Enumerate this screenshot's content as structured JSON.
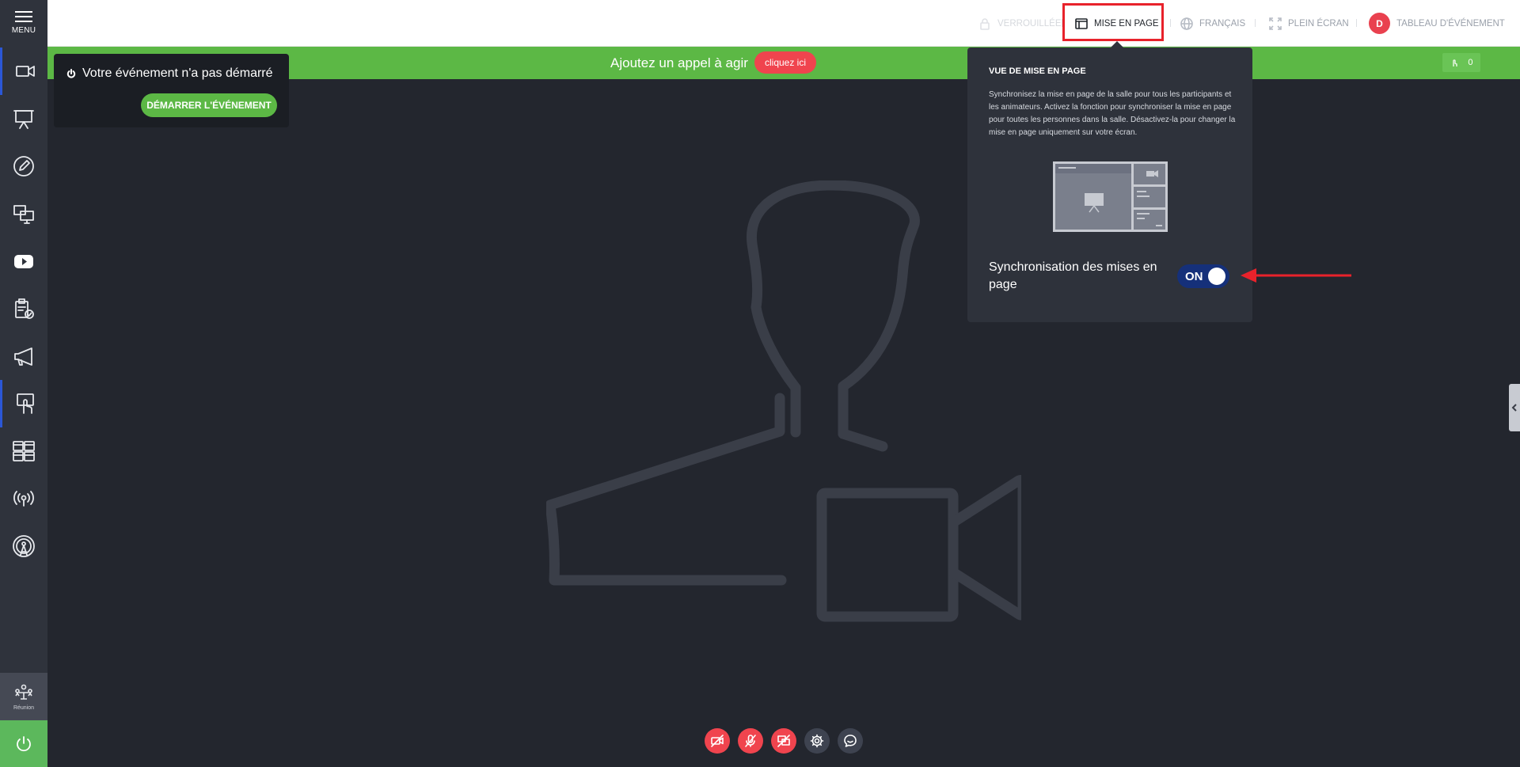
{
  "sidebar": {
    "menu_label": "MENU",
    "reunion_label": "Réunion",
    "items": [
      {
        "icon": "camera-icon"
      },
      {
        "icon": "presentation-icon"
      },
      {
        "icon": "pencil-icon"
      },
      {
        "icon": "screenshare-icon"
      },
      {
        "icon": "youtube-icon"
      },
      {
        "icon": "clipboard-check-icon"
      },
      {
        "icon": "megaphone-icon"
      },
      {
        "icon": "touch-icon"
      },
      {
        "icon": "layouts-icon"
      },
      {
        "icon": "broadcast-icon"
      },
      {
        "icon": "antenna-icon"
      }
    ]
  },
  "topbar": {
    "locked_label": "VERROUILLÉE",
    "layout_label": "MISE EN PAGE",
    "language_label": "FRANÇAIS",
    "fullscreen_label": "PLEIN ÉCRAN",
    "avatar_initial": "D",
    "dashboard_label": "TABLEAU D'ÉVÉNEMENT"
  },
  "banner": {
    "text": "Ajoutez un appel à agir",
    "cta_label": "cliquez ici",
    "count": "0"
  },
  "event_card": {
    "status": "Votre événement n'a pas démarré",
    "start_button": "DÉMARRER L'ÉVÉNEMENT"
  },
  "layout_popover": {
    "title": "VUE DE MISE EN PAGE",
    "description": "Synchronisez la mise en page de la salle pour tous les participants et les animateurs. Activez la fonction pour synchroniser la mise en page pour toutes les personnes dans la salle. Désactivez-la pour changer la mise en page uniquement sur votre écran.",
    "sync_label": "Synchronisation des mises en page",
    "toggle_state": "ON"
  },
  "colors": {
    "accent_green": "#5cb845",
    "accent_red": "#f0444e",
    "toggle_blue": "#15307a",
    "highlight_red": "#e8222b"
  }
}
